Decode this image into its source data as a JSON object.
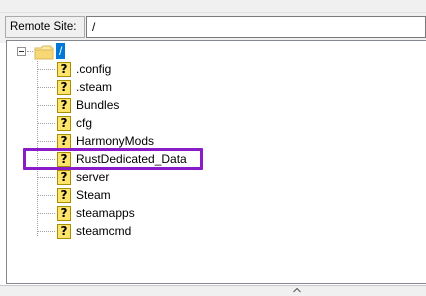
{
  "remote_site": {
    "label": "Remote Site:",
    "path": "/"
  },
  "tree": {
    "root": {
      "label": "/",
      "icon": "folder-icon",
      "expanded": true,
      "selected": true
    },
    "children": [
      {
        "label": ".config",
        "icon": "question-mark-icon"
      },
      {
        "label": ".steam",
        "icon": "question-mark-icon"
      },
      {
        "label": "Bundles",
        "icon": "question-mark-icon"
      },
      {
        "label": "cfg",
        "icon": "question-mark-icon"
      },
      {
        "label": "HarmonyMods",
        "icon": "question-mark-icon"
      },
      {
        "label": "RustDedicated_Data",
        "icon": "question-mark-icon",
        "highlighted": true
      },
      {
        "label": "server",
        "icon": "question-mark-icon"
      },
      {
        "label": "Steam",
        "icon": "question-mark-icon"
      },
      {
        "label": "steamapps",
        "icon": "question-mark-icon"
      },
      {
        "label": "steamcmd",
        "icon": "question-mark-icon"
      }
    ],
    "unknown_icon_glyph": "?"
  },
  "colors": {
    "selection": "#0078d7",
    "highlight_box": "#8a1bc9",
    "unknown_icon_fill": "#ffe46b"
  }
}
